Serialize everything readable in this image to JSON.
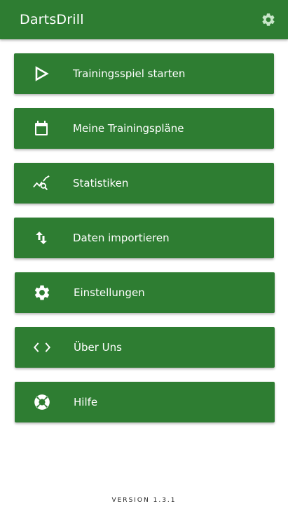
{
  "app": {
    "title": "DartsDrill",
    "version_label": "VERSION 1.3.1"
  },
  "colors": {
    "primary": "#2e7d32",
    "on_primary": "#ffffff",
    "background": "#ffffff"
  },
  "menu": [
    {
      "label": "Trainingsspiel starten",
      "icon": "play-icon"
    },
    {
      "label": "Meine Trainingspläne",
      "icon": "calendar-icon"
    },
    {
      "label": "Statistiken",
      "icon": "stats-search-icon"
    },
    {
      "label": "Daten importieren",
      "icon": "import-arrows-icon"
    },
    {
      "label": "Einstellungen",
      "icon": "gear-icon"
    },
    {
      "label": "Über Uns",
      "icon": "code-icon"
    },
    {
      "label": "Hilfe",
      "icon": "lifebuoy-icon"
    }
  ]
}
